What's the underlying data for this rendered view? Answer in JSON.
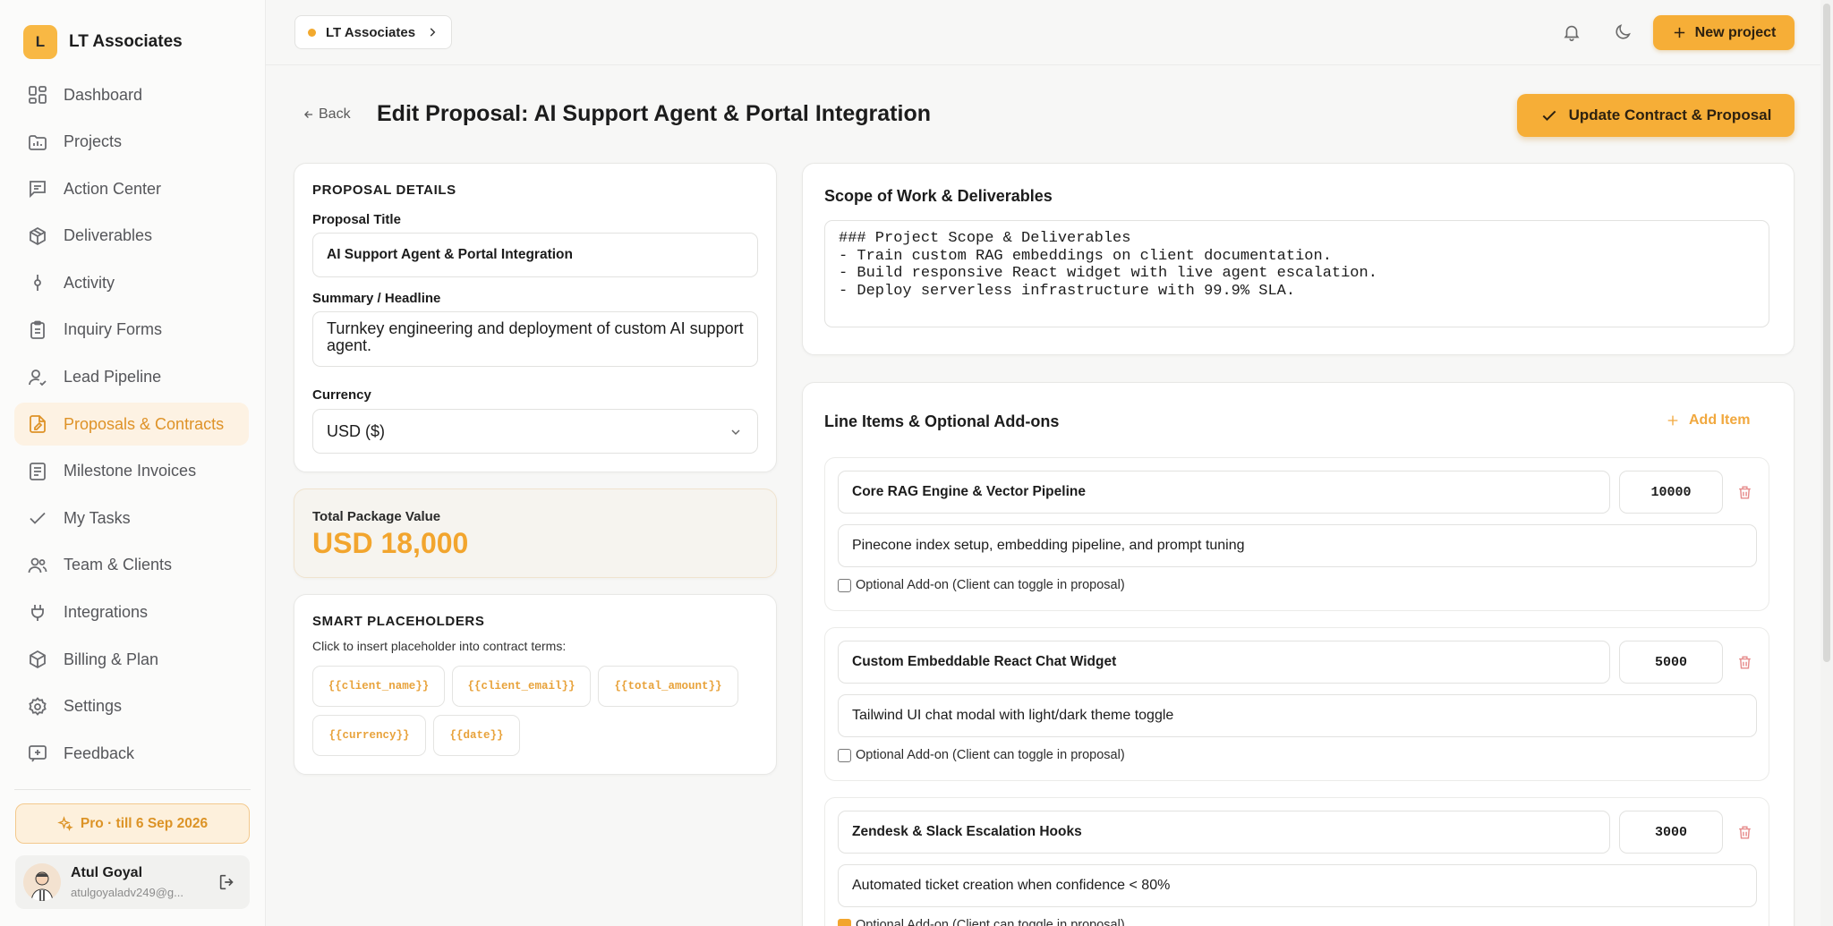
{
  "brand": {
    "initial": "L",
    "name": "LT Associates"
  },
  "sidebar": {
    "items": [
      {
        "label": "Dashboard",
        "icon": "dashboard-icon"
      },
      {
        "label": "Projects",
        "icon": "projects-icon"
      },
      {
        "label": "Action Center",
        "icon": "action-center-icon"
      },
      {
        "label": "Deliverables",
        "icon": "package-icon"
      },
      {
        "label": "Activity",
        "icon": "activity-icon"
      },
      {
        "label": "Inquiry Forms",
        "icon": "clipboard-icon"
      },
      {
        "label": "Lead Pipeline",
        "icon": "lead-icon"
      },
      {
        "label": "Proposals & Contracts",
        "icon": "contract-icon",
        "active": true
      },
      {
        "label": "Milestone Invoices",
        "icon": "invoice-icon"
      },
      {
        "label": "My Tasks",
        "icon": "check-icon"
      },
      {
        "label": "Team & Clients",
        "icon": "users-icon"
      },
      {
        "label": "Integrations",
        "icon": "plug-icon"
      },
      {
        "label": "Billing & Plan",
        "icon": "billing-icon"
      },
      {
        "label": "Settings",
        "icon": "gear-icon"
      },
      {
        "label": "Feedback",
        "icon": "feedback-icon"
      }
    ],
    "plan": "Pro · till 6 Sep 2026",
    "user": {
      "name": "Atul Goyal",
      "email": "atulgoyaladv249@g..."
    }
  },
  "topbar": {
    "workspace": "LT Associates",
    "new_project": "New project"
  },
  "header": {
    "back": "Back",
    "title": "Edit Proposal: AI Support Agent & Portal Integration",
    "update": "Update Contract & Proposal"
  },
  "details": {
    "heading": "PROPOSAL DETAILS",
    "title_label": "Proposal Title",
    "title_value": "AI Support Agent & Portal Integration",
    "summary_label": "Summary / Headline",
    "summary_value": "Turnkey engineering and deployment of custom AI support agent.",
    "currency_label": "Currency",
    "currency_value": "USD ($)"
  },
  "total": {
    "label": "Total Package Value",
    "value": "USD 18,000"
  },
  "placeholders": {
    "heading": "SMART PLACEHOLDERS",
    "help": "Click to insert placeholder into contract terms:",
    "chips": [
      "{{client_name}}",
      "{{client_email}}",
      "{{total_amount}}",
      "{{currency}}",
      "{{date}}"
    ]
  },
  "scope": {
    "title": "Scope of Work & Deliverables",
    "lines": [
      "### Project Scope & Deliverables",
      "",
      "- Train custom RAG embeddings on client documentation.",
      "- Build responsive React widget with live agent escalation.",
      "- Deploy serverless infrastructure with 99.9% SLA."
    ]
  },
  "line_items": {
    "title": "Line Items & Optional Add-ons",
    "add_label": "Add Item",
    "optional_label": "Optional Add-on (Client can toggle in proposal)",
    "items": [
      {
        "name": "Core RAG Engine & Vector Pipeline",
        "amount": "10000",
        "description": "Pinecone index setup, embedding pipeline, and prompt tuning",
        "optional": false
      },
      {
        "name": "Custom Embeddable React Chat Widget",
        "amount": "5000",
        "description": "Tailwind UI chat modal with light/dark theme toggle",
        "optional": false
      },
      {
        "name": "Zendesk & Slack Escalation Hooks",
        "amount": "3000",
        "description": "Automated ticket creation when confidence < 80%",
        "optional": true
      }
    ]
  },
  "colors": {
    "accent": "#f6ae37",
    "active_bg": "#fdf2e3",
    "active_text": "#de9227",
    "danger": "#e68b8b"
  }
}
